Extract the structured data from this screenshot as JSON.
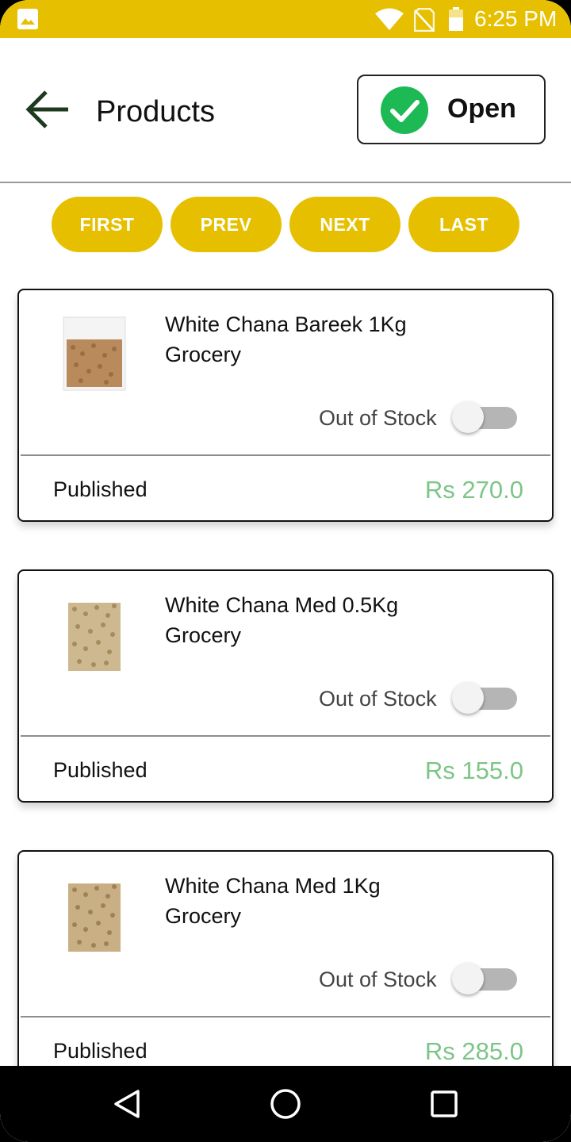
{
  "status_bar": {
    "time": "6:25 PM",
    "color": "#E6C000",
    "icons": [
      "gallery-icon",
      "wifi-icon",
      "no-sim-icon",
      "battery-icon"
    ]
  },
  "header": {
    "title": "Products",
    "back_icon": "arrow-left-icon",
    "open_button": {
      "label": "Open",
      "icon": "check-circle-icon",
      "icon_color": "#1DB954"
    }
  },
  "pager": {
    "first": "FIRST",
    "prev": "PREV",
    "next": "NEXT",
    "last": "LAST"
  },
  "products": [
    {
      "name": "White Chana Bareek 1Kg",
      "category": "Grocery",
      "stock_label": "Out of Stock",
      "out_of_stock": false,
      "status": "Published",
      "price": "Rs 270.0"
    },
    {
      "name": "White Chana Med 0.5Kg",
      "category": "Grocery",
      "stock_label": "Out of Stock",
      "out_of_stock": false,
      "status": "Published",
      "price": "Rs 155.0"
    },
    {
      "name": "White Chana Med 1Kg",
      "category": "Grocery",
      "stock_label": "Out of Stock",
      "out_of_stock": false,
      "status": "Published",
      "price": "Rs 285.0"
    }
  ],
  "colors": {
    "accent": "#E6C000",
    "price": "#7DC587"
  },
  "nav_bar": {
    "icons": [
      "nav-back-icon",
      "nav-home-icon",
      "nav-recent-icon"
    ]
  }
}
